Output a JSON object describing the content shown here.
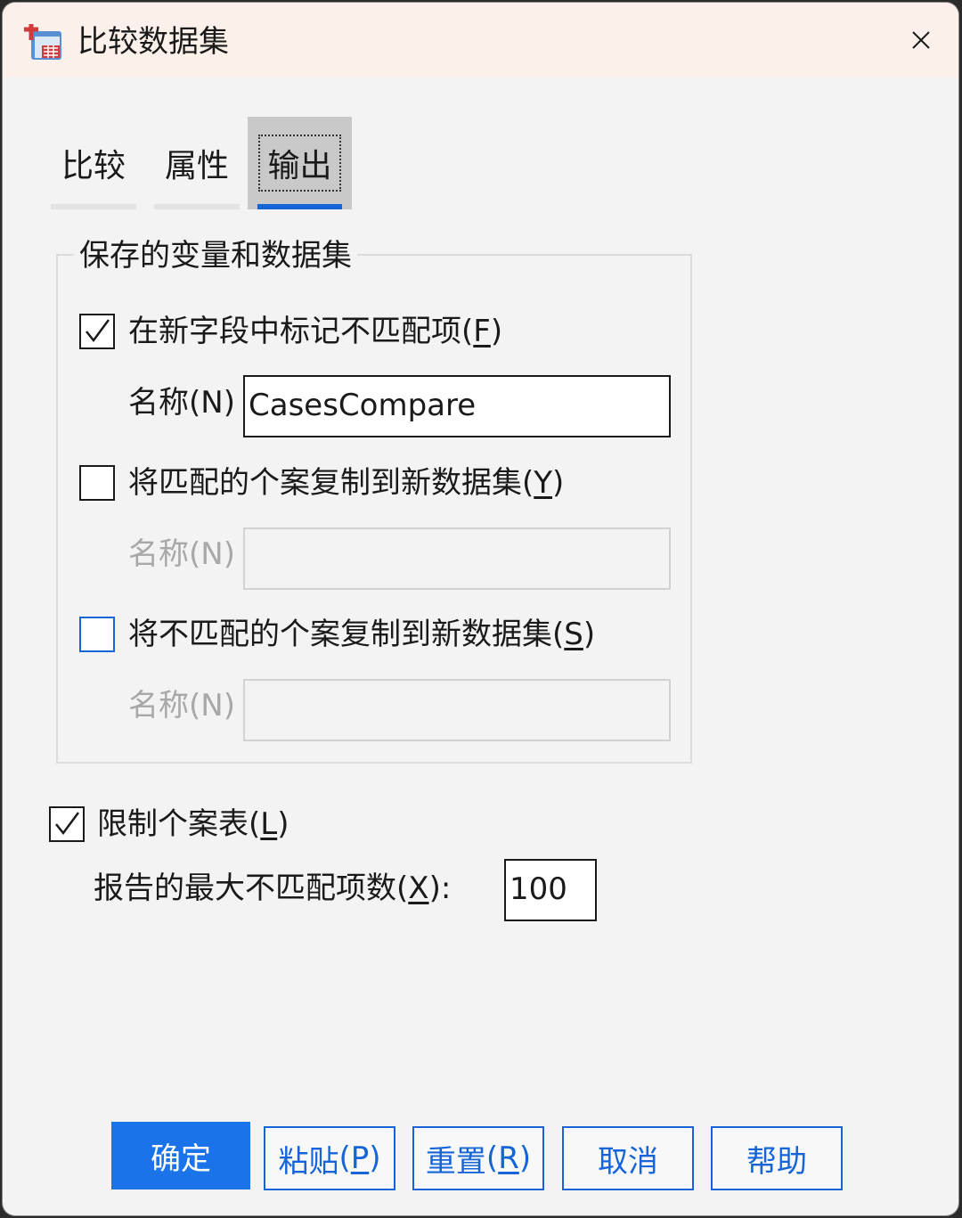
{
  "window": {
    "title": "比较数据集",
    "app_icon": "spss-dataset-icon",
    "close_icon": "close-icon"
  },
  "tabs": [
    {
      "label": "比较",
      "active": false
    },
    {
      "label": "属性",
      "active": false
    },
    {
      "label": "输出",
      "active": true
    }
  ],
  "saved_group": {
    "legend": "保存的变量和数据集",
    "flag_mismatch": {
      "label": "在新字段中标记不匹配项",
      "mnemonic": "F",
      "checked": true,
      "name_label": "名称(N)",
      "name_value": "CasesCompare"
    },
    "copy_matched": {
      "label": "将匹配的个案复制到新数据集",
      "mnemonic": "Y",
      "checked": false,
      "name_label": "名称(N)",
      "name_value": ""
    },
    "copy_unmatched": {
      "label": "将不匹配的个案复制到新数据集",
      "mnemonic": "S",
      "checked": false,
      "name_label": "名称(N)",
      "name_value": ""
    }
  },
  "limit_table": {
    "label": "限制个案表",
    "mnemonic": "L",
    "checked": true,
    "max_label": "报告的最大不匹配项数",
    "max_mnemonic": "X",
    "max_colon": ":",
    "max_value": "100"
  },
  "buttons": {
    "ok": "确定",
    "paste": {
      "text": "粘贴",
      "mnemonic": "P"
    },
    "reset": {
      "text": "重置",
      "mnemonic": "R"
    },
    "cancel": "取消",
    "help": "帮助"
  },
  "colors": {
    "accent": "#1565d8",
    "primary_button": "#1a73e8",
    "titlebar": "#fbf1ea",
    "background": "#f3f3f3"
  }
}
